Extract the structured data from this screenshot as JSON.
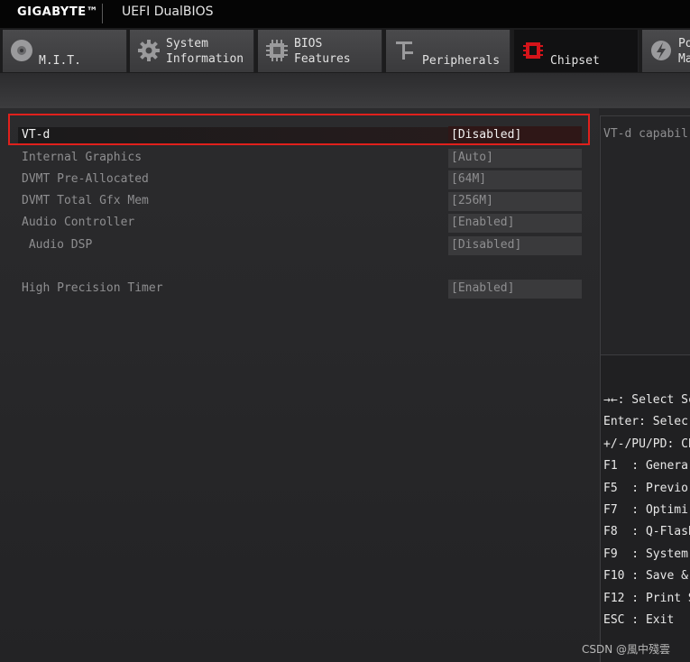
{
  "header": {
    "brand": "GIGABYTE™",
    "product": "UEFI DualBIOS"
  },
  "tabs": [
    {
      "line1": "",
      "line2": "M.I.T.",
      "icon": "disc-icon",
      "active": false
    },
    {
      "line1": "System",
      "line2": "Information",
      "icon": "gear-icon",
      "active": false
    },
    {
      "line1": "BIOS",
      "line2": "Features",
      "icon": "chip-icon",
      "active": false
    },
    {
      "line1": "",
      "line2": "Peripherals",
      "icon": "plug-icon",
      "active": false
    },
    {
      "line1": "",
      "line2": "Chipset",
      "icon": "chipset-icon",
      "active": true
    },
    {
      "line1": "Po",
      "line2": "Ma",
      "icon": "power-icon",
      "active": false
    }
  ],
  "settings": [
    {
      "label": "VT-d",
      "value": "[Disabled]",
      "selected": true
    },
    {
      "label": "Internal Graphics",
      "value": "[Auto]",
      "selected": false
    },
    {
      "label": "DVMT Pre-Allocated",
      "value": "[64M]",
      "selected": false
    },
    {
      "label": "DVMT Total Gfx Mem",
      "value": "[256M]",
      "selected": false
    },
    {
      "label": "Audio Controller",
      "value": "[Enabled]",
      "selected": false
    },
    {
      "label": " Audio DSP",
      "value": "[Disabled]",
      "selected": false
    },
    {
      "label": "High Precision Timer",
      "value": "[Enabled]",
      "selected": false
    }
  ],
  "help": {
    "description": "VT-d capabil"
  },
  "keys": [
    "→←: Select Sc",
    "Enter: Selec",
    "+/-/PU/PD: Ch",
    "F1  : Genera",
    "F5  : Previo",
    "F7  : Optimi",
    "F8  : Q-Flash",
    "F9  : System",
    "F10 : Save &",
    "F12 : Print S",
    "ESC : Exit"
  ],
  "watermark": "CSDN @風中殘雲",
  "colors": {
    "accent_red": "#e0201c",
    "chipset_icon_red": "#d4141a"
  }
}
